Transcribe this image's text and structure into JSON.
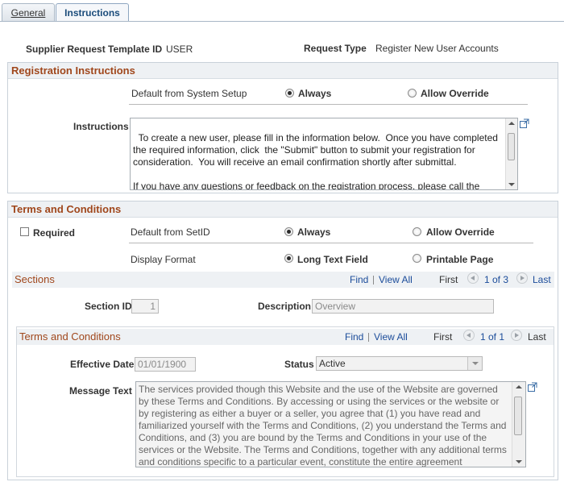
{
  "tabs": [
    {
      "label": "General",
      "active": false
    },
    {
      "label": "Instructions",
      "active": true
    }
  ],
  "header": {
    "template_id_label": "Supplier Request Template ID",
    "template_id_value": "USER",
    "request_type_label": "Request Type",
    "request_type_value": "Register New User Accounts"
  },
  "registration": {
    "title": "Registration Instructions",
    "default_label": "Default from System Setup",
    "opt_always": "Always",
    "opt_override": "Allow Override",
    "selected": "Always",
    "instructions_label": "Instructions",
    "instructions_text": "To create a new user, please fill in the information below.  Once you have completed the required information, click  the \"Submit\" button to submit your registration for consideration.  You will receive an email confirmation shortly after submittal.\n\nIf you have any questions or feedback on the registration process, please call the application processing service center at:"
  },
  "terms": {
    "title": "Terms and Conditions",
    "required_label": "Required",
    "required_checked": false,
    "default_label": "Default from SetID",
    "opt_always": "Always",
    "opt_override": "Allow Override",
    "default_selected": "Always",
    "display_format_label": "Display Format",
    "opt_long_text": "Long Text Field",
    "opt_printable": "Printable Page",
    "display_selected": "Long Text Field"
  },
  "sections": {
    "title": "Sections",
    "find": "Find",
    "view_all": "View All",
    "first": "First",
    "range": "1 of 3",
    "last": "Last",
    "section_id_label": "Section ID",
    "section_id_value": "1",
    "description_label": "Description",
    "description_value": "Overview"
  },
  "tc_inner": {
    "title": "Terms and Conditions",
    "find": "Find",
    "view_all": "View All",
    "first": "First",
    "range": "1 of 1",
    "last": "Last",
    "effective_date_label": "Effective Date",
    "effective_date_value": "01/01/1900",
    "status_label": "Status",
    "status_value": "Active",
    "message_text_label": "Message Text",
    "message_text": "The services provided though this Website and the use of the Website are governed by these Terms and Conditions.  By accessing or using the services or the website or by registering as either a buyer or a seller, you agree that (1) you have read and familiarized yourself with the Terms and Conditions, (2) you understand the Terms and Conditions, and (3) you are bound by the Terms and Conditions in your use of the services or the Website.  The Terms and Conditions, together with any additional terms and conditions specific to a particular event, constitute the entire agreement"
  }
}
